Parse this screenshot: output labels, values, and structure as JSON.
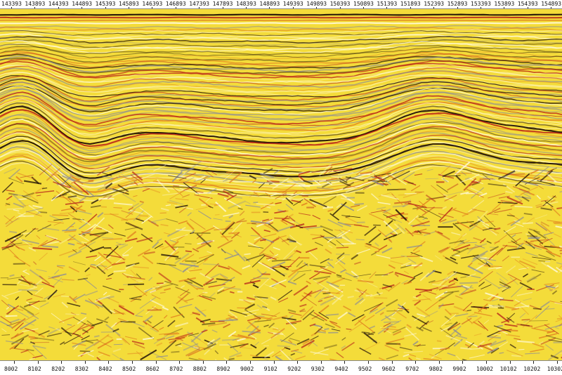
{
  "top_axis": {
    "labels": [
      "143393",
      "143893",
      "144393",
      "144893",
      "145393",
      "145893",
      "146393",
      "146893",
      "147393",
      "147893",
      "148393",
      "148893",
      "149393",
      "149893",
      "150393",
      "150893",
      "151393",
      "151893",
      "152393",
      "152893",
      "153393",
      "153893",
      "154393",
      "154893"
    ]
  },
  "bottom_axis": {
    "labels": [
      "8002",
      "8102",
      "8202",
      "8302",
      "8402",
      "8502",
      "8602",
      "8702",
      "8802",
      "8902",
      "9002",
      "9102",
      "9202",
      "9302",
      "9402",
      "9502",
      "9602",
      "9702",
      "9802",
      "9902",
      "10002",
      "10102",
      "10202",
      "10302"
    ]
  },
  "colors": {
    "background": "#f4dc3a",
    "peak_dark": "#1a0a05",
    "peak_red": "#b8241a",
    "peak_orange": "#e07a1e",
    "trough_light": "#fffbe0",
    "trough_grey": "#8a8a9a"
  }
}
